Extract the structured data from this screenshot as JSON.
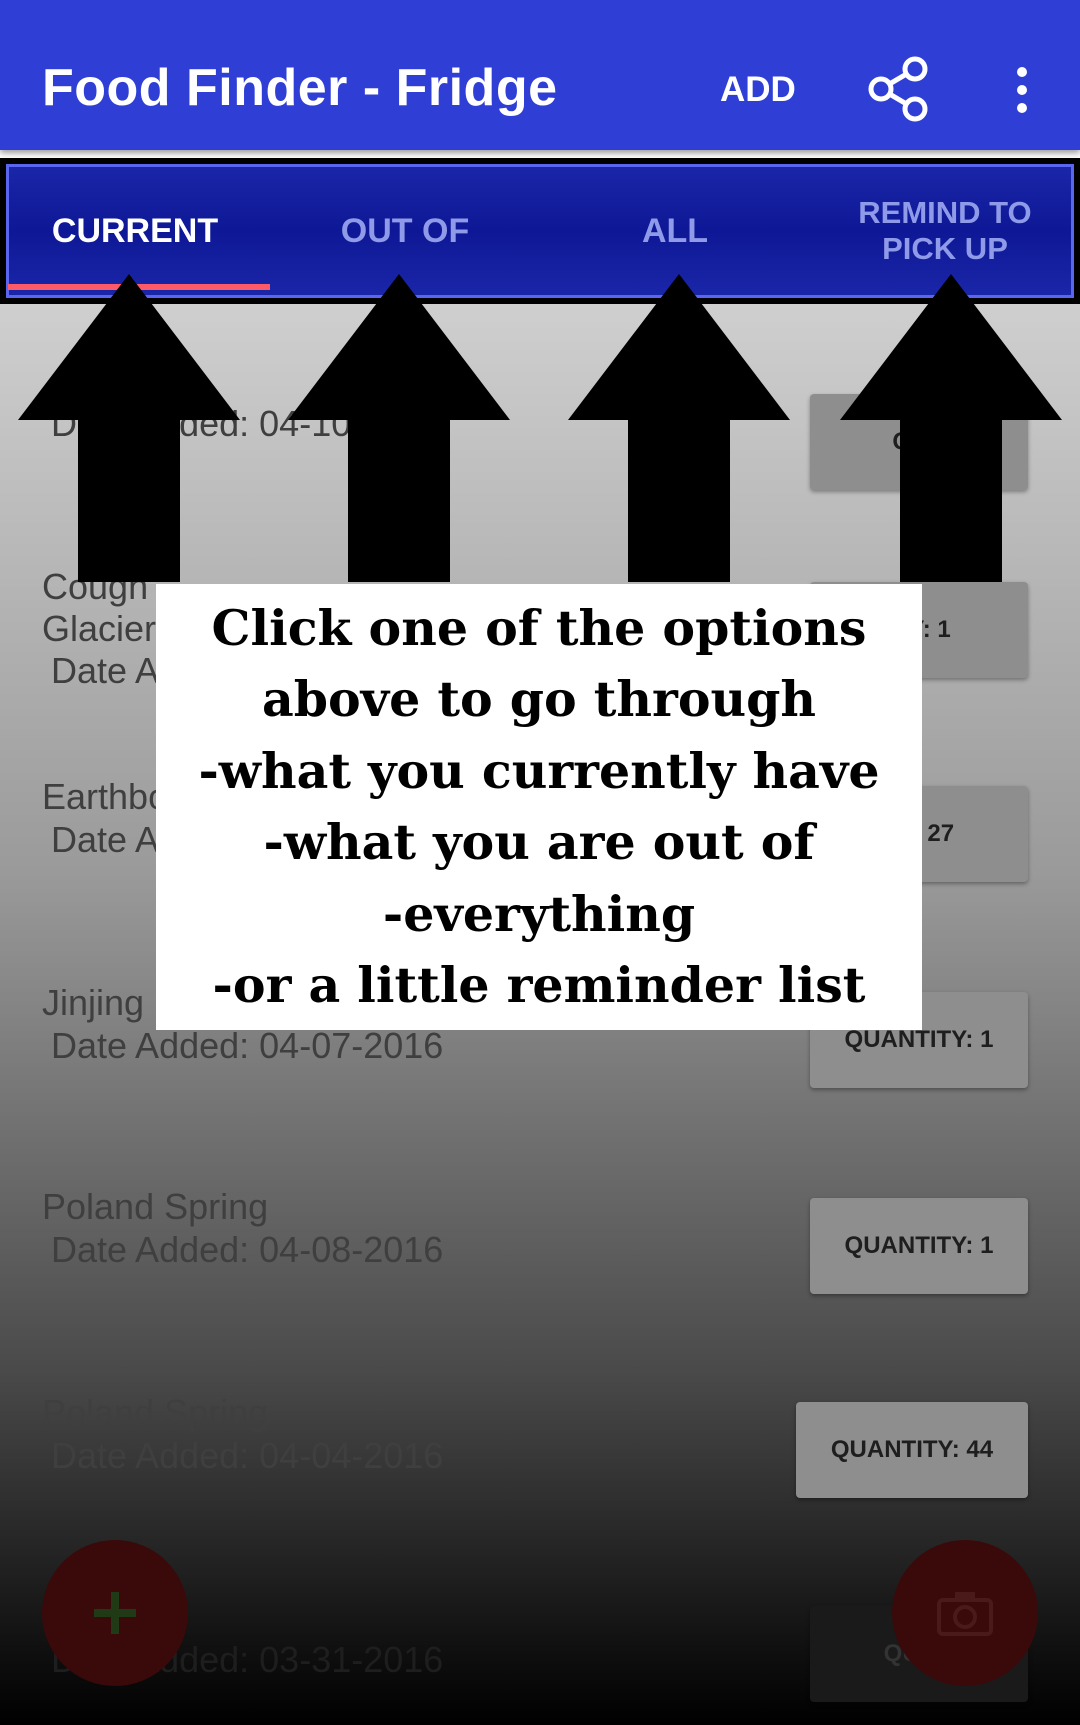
{
  "appbar": {
    "title": "Food Finder - Fridge",
    "add_label": "ADD",
    "share_icon": "share-icon",
    "overflow_icon": "overflow-menu-icon",
    "color": "#2f3fd6"
  },
  "tabs": [
    {
      "label": "CURRENT",
      "active": true
    },
    {
      "label": "OUT OF",
      "active": false
    },
    {
      "label": "ALL",
      "active": false
    },
    {
      "label": "REMIND TO PICK UP",
      "active": false
    }
  ],
  "tab_colors": {
    "bar": "#0e1896",
    "indicator": "#ff5a67"
  },
  "items": [
    {
      "name": "",
      "date": "Date Added: 04-10",
      "quantity": "QUA"
    },
    {
      "name": "Cough",
      "name2": "Glacier",
      "date": "Date A",
      "quantity": "ITY: 1"
    },
    {
      "name": "Earthbo",
      "date": "Date A",
      "quantity": "TY: 27"
    },
    {
      "name": "Jinjing",
      "date": "Date Added: 04-07-2016",
      "quantity": "QUANTITY: 1"
    },
    {
      "name": "Poland Spring",
      "date": "Date Added: 04-08-2016",
      "quantity": "QUANTITY: 1"
    },
    {
      "name": "Poland Spring",
      "date": "Date Added: 04-04-2016",
      "quantity": "QUANTITY: 44"
    },
    {
      "name": "",
      "date": "Date Added: 03-31-2016",
      "quantity": "QUAN"
    }
  ],
  "fab_icons": {
    "left": "plus-icon",
    "right": "camera-icon"
  },
  "overlay": {
    "lines": [
      "Click one of the options",
      "above to go through",
      "-what you currently have",
      "-what you are out of",
      "-everything",
      "-or a little reminder list"
    ]
  }
}
